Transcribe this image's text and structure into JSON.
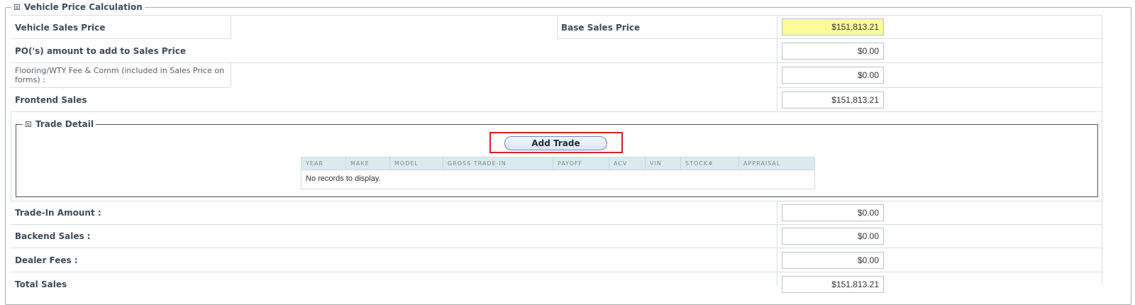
{
  "section": {
    "title": "Vehicle Price Calculation"
  },
  "rows": {
    "vehicle_sales_price_label": "Vehicle Sales Price",
    "base_sales_price_label": "Base Sales Price",
    "base_sales_price_value": "$151,813.21",
    "po_amount_label": "PO('s) amount to add to Sales Price",
    "po_amount_value": "$0.00",
    "flooring_label": "Flooring/WTY Fee & Comm (included in Sales Price on forms) :",
    "flooring_value": "$0.00",
    "frontend_sales_label": "Frontend Sales",
    "frontend_sales_value": "$151,813.21",
    "trade_in_amount_label": "Trade-In Amount :",
    "trade_in_amount_value": "$0.00",
    "backend_sales_label": "Backend Sales :",
    "backend_sales_value": "$0.00",
    "dealer_fees_label": "Dealer Fees :",
    "dealer_fees_value": "$0.00",
    "total_sales_label": "Total Sales",
    "total_sales_value": "$151,813.21"
  },
  "trade_detail": {
    "title": "Trade Detail",
    "add_button": "Add Trade",
    "columns": [
      "YEAR",
      "MAKE",
      "MODEL",
      "GROSS TRADE-IN",
      "PAYOFF",
      "ACV",
      "VIN",
      "STOCK#",
      "APPRAISAL"
    ],
    "empty_message": "No records to display."
  },
  "colors": {
    "highlight": "#fbfb9a",
    "button_outline": "#d92222"
  }
}
